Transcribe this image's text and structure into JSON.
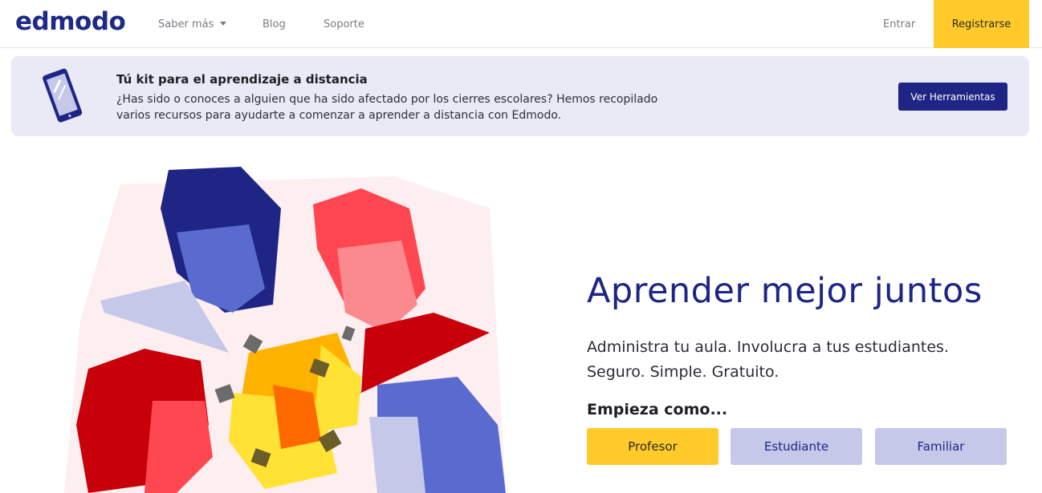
{
  "nav": {
    "logo": "edmodo",
    "saber_mas": "Saber más",
    "blog": "Blog",
    "soporte": "Soporte",
    "entrar": "Entrar",
    "registrarse": "Registrarse"
  },
  "banner": {
    "title": "Tú kit para el aprendizaje a distancia",
    "text": "¿Has sido o conoces a alguien que ha sido afectado por los cierres escolares? Hemos recopilado varios recursos para ayudarte a comenzar a aprender a distancia con Edmodo.",
    "button": "Ver Herramientas",
    "icon": "phone-icon"
  },
  "hero": {
    "title": "Aprender mejor juntos",
    "subtitle": "Administra tu aula. Involucra a tus estudiantes. Seguro. Simple. Gratuito.",
    "start_label": "Empieza como...",
    "roles": {
      "profesor": "Profesor",
      "estudiante": "Estudiante",
      "familiar": "Familiar"
    }
  },
  "colors": {
    "brand": "#1e2585",
    "accent": "#ffca2a",
    "banner_bg": "#e9eaf5",
    "secondary_button": "#c5c8e8"
  }
}
